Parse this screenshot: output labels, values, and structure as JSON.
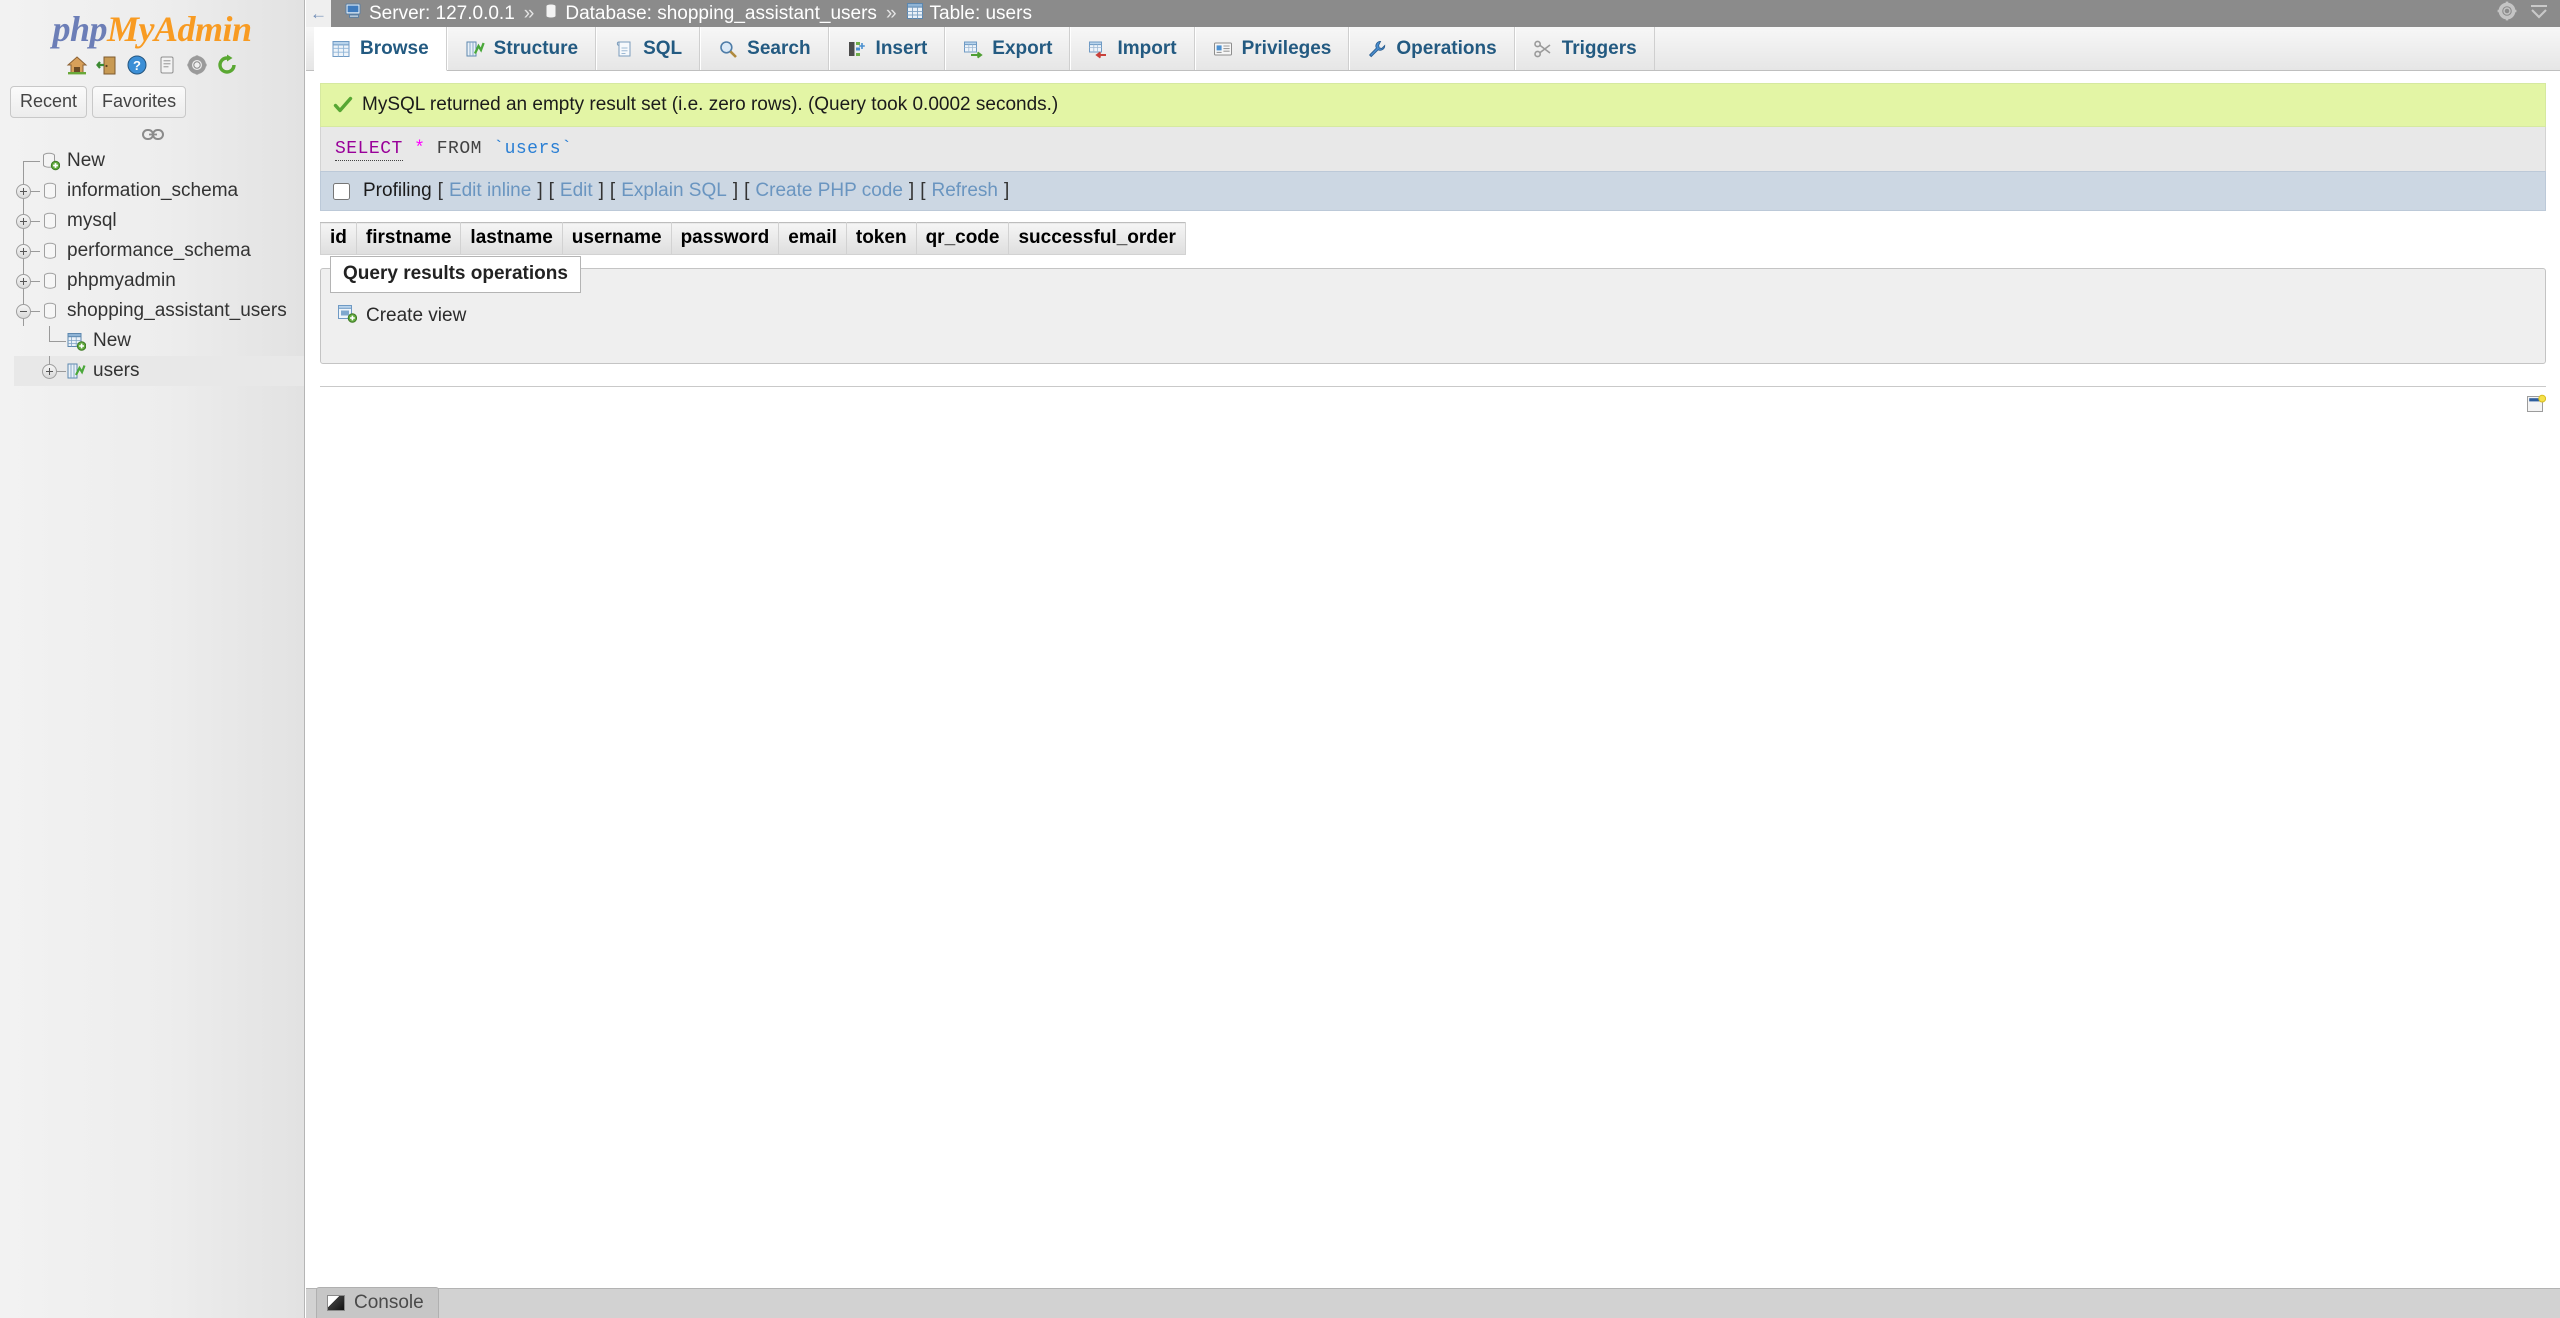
{
  "app": {
    "logo_php": "php",
    "logo_myadmin": "MyAdmin",
    "logo_icons": [
      {
        "name": "home-icon",
        "title": "Home"
      },
      {
        "name": "logout-icon",
        "title": "Log out"
      },
      {
        "name": "help-docs-icon",
        "title": "phpMyAdmin documentation"
      },
      {
        "name": "mysql-docs-icon",
        "title": "Documentation"
      },
      {
        "name": "settings-icon",
        "title": "Settings"
      },
      {
        "name": "reload-icon",
        "title": "Reload navigation"
      }
    ]
  },
  "sidebar": {
    "tabs": [
      {
        "label": "Recent",
        "name": "nav-tab-recent"
      },
      {
        "label": "Favorites",
        "name": "nav-tab-favorites"
      }
    ],
    "link_icon": "chain-link-icon",
    "tree": [
      {
        "label": "New",
        "icon": "database-new-icon",
        "expander": "none",
        "level": 1,
        "selected": false
      },
      {
        "label": "information_schema",
        "icon": "database-icon",
        "expander": "plus",
        "level": 1,
        "selected": false
      },
      {
        "label": "mysql",
        "icon": "database-icon",
        "expander": "plus",
        "level": 1,
        "selected": false
      },
      {
        "label": "performance_schema",
        "icon": "database-icon",
        "expander": "plus",
        "level": 1,
        "selected": false
      },
      {
        "label": "phpmyadmin",
        "icon": "database-icon",
        "expander": "plus",
        "level": 1,
        "selected": false
      },
      {
        "label": "shopping_assistant_users",
        "icon": "database-icon",
        "expander": "minus",
        "level": 1,
        "selected": false
      },
      {
        "label": "New",
        "icon": "table-new-icon",
        "expander": "none",
        "level": 2,
        "selected": false
      },
      {
        "label": "users",
        "icon": "table-structure-icon",
        "expander": "plus",
        "level": 2,
        "selected": true
      }
    ]
  },
  "topbar": {
    "back_label": "←",
    "breadcrumb": [
      {
        "icon": "server-icon",
        "text": "Server: 127.0.0.1"
      },
      {
        "icon": "database-icon",
        "text": "Database: shopping_assistant_users"
      },
      {
        "icon": "table-icon",
        "text": "Table: users"
      }
    ],
    "separator": "»",
    "right_icons": [
      {
        "name": "gear-icon"
      },
      {
        "name": "collapse-up-icon"
      }
    ]
  },
  "main_tabs": [
    {
      "label": "Browse",
      "name": "tab-browse",
      "icon": "browse-icon",
      "active": true
    },
    {
      "label": "Structure",
      "name": "tab-structure",
      "icon": "structure-icon",
      "active": false
    },
    {
      "label": "SQL",
      "name": "tab-sql",
      "icon": "sql-icon",
      "active": false
    },
    {
      "label": "Search",
      "name": "tab-search",
      "icon": "search-icon",
      "active": false
    },
    {
      "label": "Insert",
      "name": "tab-insert",
      "icon": "insert-icon",
      "active": false
    },
    {
      "label": "Export",
      "name": "tab-export",
      "icon": "export-icon",
      "active": false
    },
    {
      "label": "Import",
      "name": "tab-import",
      "icon": "import-icon",
      "active": false
    },
    {
      "label": "Privileges",
      "name": "tab-privileges",
      "icon": "privileges-icon",
      "active": false
    },
    {
      "label": "Operations",
      "name": "tab-operations",
      "icon": "wrench-icon",
      "active": false
    },
    {
      "label": "Triggers",
      "name": "tab-triggers",
      "icon": "triggers-icon",
      "active": false
    }
  ],
  "notice": {
    "icon": "success-check-icon",
    "text": "MySQL returned an empty result set (i.e. zero rows). (Query took 0.0002 seconds.)"
  },
  "sql": {
    "keyword_select": "SELECT",
    "star": "*",
    "keyword_from": "FROM",
    "identifier": "`users`"
  },
  "profiling": {
    "label": "Profiling",
    "checked": false,
    "links": [
      {
        "label": "Edit inline",
        "name": "link-edit-inline"
      },
      {
        "label": "Edit",
        "name": "link-edit"
      },
      {
        "label": "Explain SQL",
        "name": "link-explain-sql"
      },
      {
        "label": "Create PHP code",
        "name": "link-create-php-code"
      },
      {
        "label": "Refresh",
        "name": "link-refresh"
      }
    ],
    "bracket_open": "[",
    "bracket_close": "]"
  },
  "results": {
    "columns": [
      "id",
      "firstname",
      "lastname",
      "username",
      "password",
      "email",
      "token",
      "qr_code",
      "successful_order"
    ],
    "rows": []
  },
  "query_results_operations": {
    "legend": "Query results operations",
    "actions": [
      {
        "label": "Create view",
        "icon": "create-view-icon",
        "name": "create-view-link"
      }
    ]
  },
  "footer": {
    "bookmark_icon": "query-window-icon"
  },
  "console": {
    "label": "Console",
    "icon": "console-icon"
  },
  "colors": {
    "topbar_bg": "#8b8b8b",
    "success_bg": "#e3f5a5",
    "profiling_bg": "#ccd7e3",
    "sql_box_bg": "#e8e8e8",
    "tab_link": "#235a81",
    "link_blue": "#6a95c0",
    "logo_orange": "#f89b22",
    "logo_blue": "#6c7eb7"
  }
}
